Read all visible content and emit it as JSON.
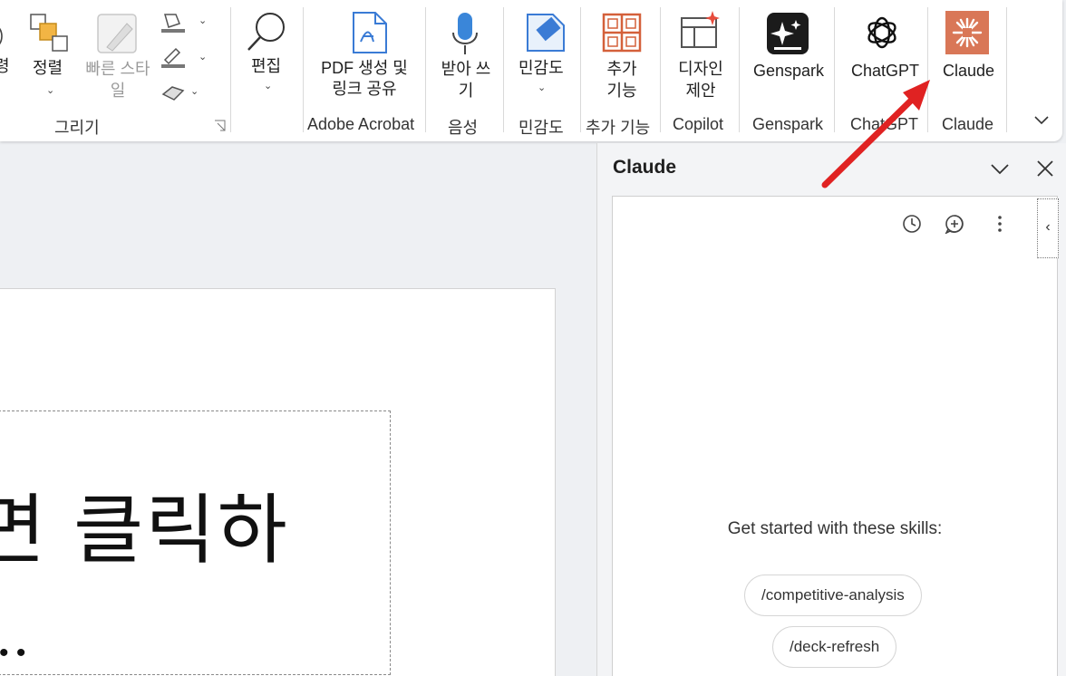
{
  "ribbon": {
    "draw": {
      "arrange_label": "정렬",
      "quick_styles_label": "빠른 스타일",
      "group_label": "그리기"
    },
    "edit": {
      "label": "편집"
    },
    "acrobat": {
      "pdf_label": "PDF 생성 및 링크 공유",
      "group_label": "Adobe Acrobat"
    },
    "voice": {
      "dictate_label": "받아 쓰기",
      "group_label": "음성"
    },
    "sensitivity": {
      "label": "민감도",
      "group_label": "민감도"
    },
    "addins": {
      "label": "추가 기능",
      "group_label": "추가 기능"
    },
    "copilot": {
      "designer_label": "디자인 제안",
      "group_label": "Copilot"
    },
    "genspark": {
      "label": "Genspark",
      "group_label": "Genspark"
    },
    "chatgpt": {
      "label": "ChatGPT",
      "group_label": "ChatGPT"
    },
    "claude": {
      "label": "Claude",
      "group_label": "Claude"
    }
  },
  "slide": {
    "title_text": "면 클릭하",
    "trail_text": "."
  },
  "pane": {
    "title": "Claude",
    "skills_heading": "Get started with these skills:",
    "skills": [
      "/competitive-analysis",
      "/deck-refresh"
    ]
  },
  "colors": {
    "claude_brand": "#d97757",
    "arrow": "#e02222",
    "designer_spark": "#e74c3c",
    "addins_grid": "#d4603a"
  }
}
